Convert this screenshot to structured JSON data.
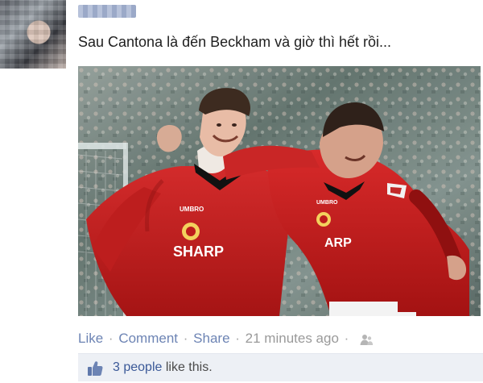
{
  "post": {
    "author_name": "",
    "text": "Sau Cantona là đến Beckham và giờ thì hết rồi..."
  },
  "photo": {
    "jersey_text_left": "SHARP",
    "jersey_text_right": "ARP",
    "jersey_brand_left": "UMBRO",
    "jersey_brand_right": "UMBRO"
  },
  "actions": {
    "like": "Like",
    "comment": "Comment",
    "share": "Share",
    "separator": "·",
    "time": "21 minutes ago"
  },
  "likes": {
    "count_link": "3 people",
    "suffix": " like this."
  },
  "icons": {
    "audience": "friends-icon",
    "like": "thumbs-up-icon"
  },
  "colors": {
    "link": "#6d84b4",
    "likes_bar_bg": "#edf0f5",
    "post_text": "#1f1f1f"
  }
}
